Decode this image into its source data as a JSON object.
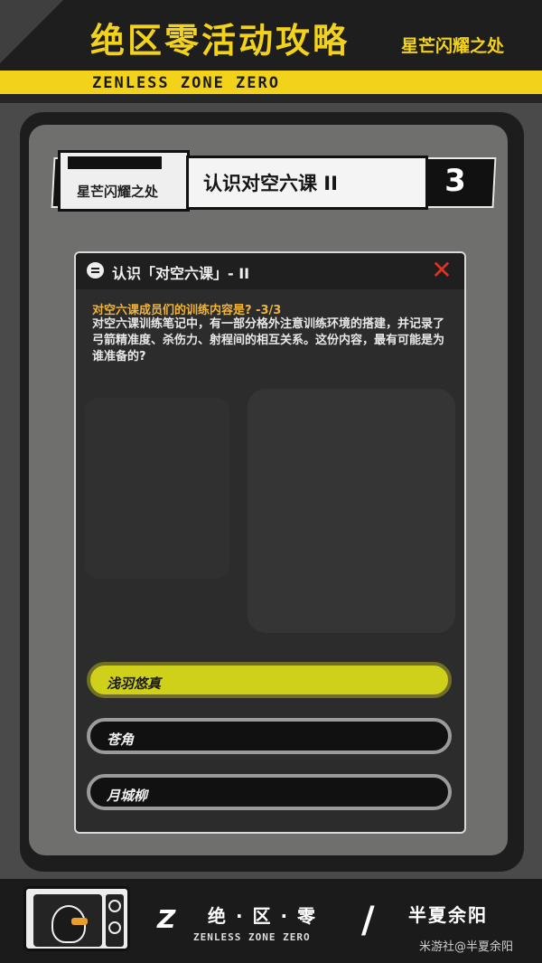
{
  "header": {
    "title": "绝区零活动攻略",
    "subtitle": "星芒闪耀之处",
    "stripe_text": "ZENLESS ZONE ZERO"
  },
  "banner": {
    "tag": "星芒闪耀之处",
    "lesson": "认识对空六课 II",
    "number": "3"
  },
  "dialog": {
    "title": "认识「对空六课」- II",
    "question_title": "对空六课成员们的训练内容是? -3/3",
    "question_body": "对空六课训练笔记中，有一部分格外注意训练环境的搭建，并记录了弓箭精准度、杀伤力、射程间的相互关系。这份内容，最有可能是为谁准备的?",
    "options": [
      {
        "label": "浅羽悠真",
        "selected": true
      },
      {
        "label": "苍角",
        "selected": false
      },
      {
        "label": "月城柳",
        "selected": false
      }
    ]
  },
  "footer": {
    "brand": "绝 · 区 · 零",
    "brand_script": "ZENLESS ZONE ZERO",
    "author": "半夏余阳",
    "watermark": "米游社@半夏余阳"
  },
  "colors": {
    "accent_yellow": "#f3d21b",
    "question_orange": "#f0b43a",
    "close_red": "#e03224",
    "selected_option": "#cfd01a"
  },
  "icons": [
    "chat-icon",
    "close-icon",
    "zzz-logo-icon",
    "mascot-avatar"
  ]
}
